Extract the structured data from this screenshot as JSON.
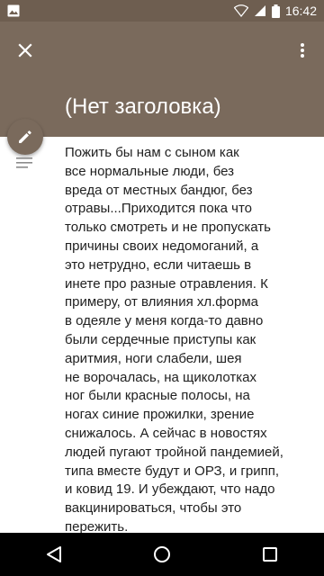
{
  "status_bar": {
    "time": "16:42",
    "icons": [
      "image-icon",
      "wifi-icon",
      "signal-icon",
      "battery-icon"
    ]
  },
  "app_bar": {
    "title": "(Нет заголовка)",
    "close_icon": "close-icon",
    "more_icon": "more-vert-icon",
    "color": "#7a6a5c"
  },
  "note": {
    "body": "Пожить бы нам с сыном как\nвсе нормальные люди, без\nвреда от местных бандюг, без\nотравы...Приходится пока что\nтолько смотреть и не пропускать\nпричины своих недомоганий, а\nэто нетрудно, если читаешь в\nинете про разные отравления. К\nпримеру, от влияния хл.форма\nв одеяле у меня когда-то давно\nбыли сердечные приступы как\nаритмия, ноги слабели, шея\nне ворочалась, на щиколотках\nног были красные полосы, на\nногах синие прожилки, зрение\nснижалось. А сейчас в новостях\nлюдей пугают тройной пандемией,\nтипа вместе будут и ОРЗ, и грипп,\nи ковид 19. И убеждают, что надо\nвакцинироваться, чтобы это\nпережить."
  },
  "fab": {
    "icon": "pencil-icon"
  },
  "nav_bar": {
    "icons": [
      "back-icon",
      "home-icon",
      "recents-icon"
    ]
  }
}
